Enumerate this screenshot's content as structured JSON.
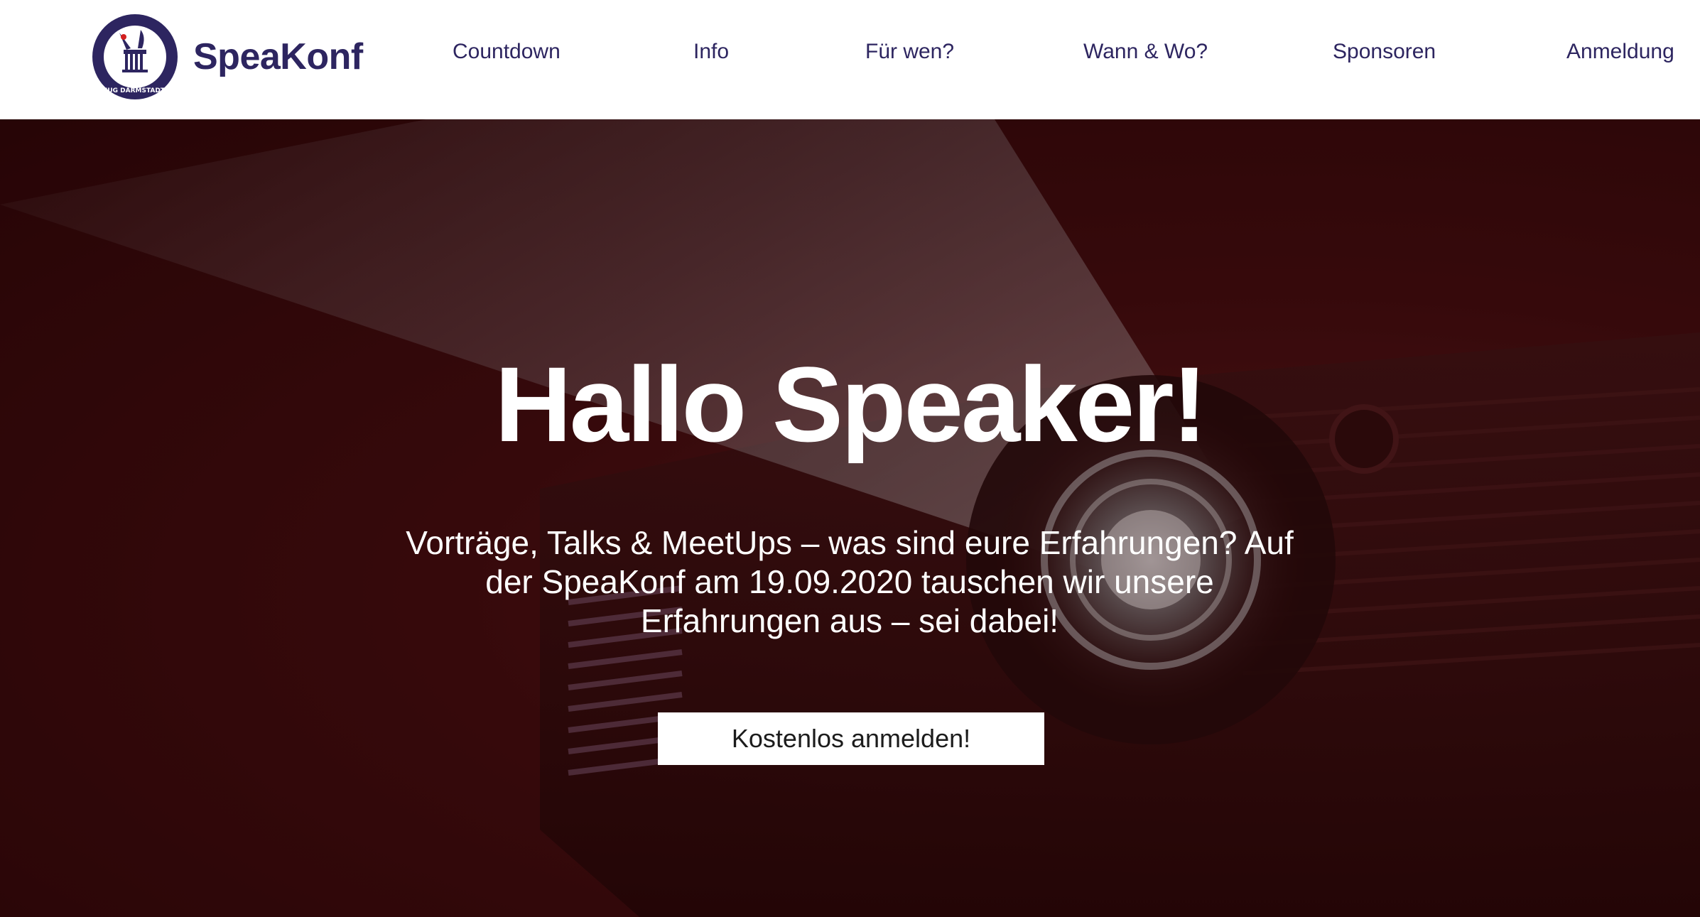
{
  "brand": {
    "name": "SpeaKonf",
    "badge_text": "JUG DARMSTADT"
  },
  "nav": {
    "items": [
      {
        "label": "Countdown"
      },
      {
        "label": "Info"
      },
      {
        "label": "Für wen?"
      },
      {
        "label": "Wann & Wo?"
      },
      {
        "label": "Sponsoren"
      },
      {
        "label": "Anmeldung"
      }
    ]
  },
  "hero": {
    "title": "Hallo Speaker!",
    "subtitle": "Vorträge, Talks & MeetUps – was sind eure Erfahrungen? Auf der SpeaKonf am 19.09.2020 tauschen wir unsere Erfahrungen aus – sei dabei!",
    "cta_label": "Kostenlos anmelden!"
  },
  "colors": {
    "brand": "#2d2560",
    "hero_overlay": "#3d0c0f",
    "text_light": "#ffffff"
  },
  "icons": {
    "logo": "jug-darmstadt-badge-icon"
  }
}
